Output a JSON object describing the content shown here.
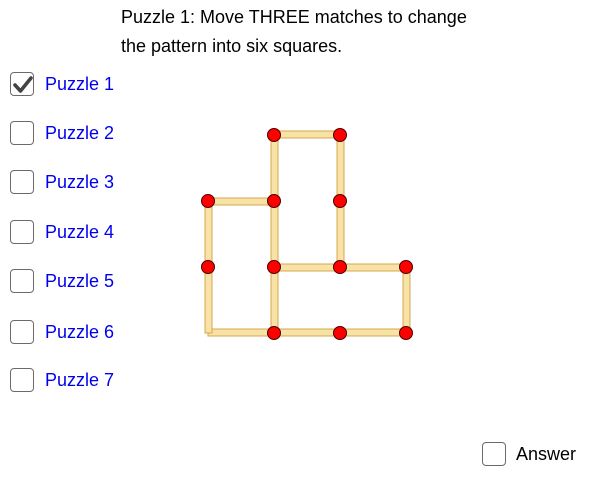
{
  "instructions": {
    "line1": "Puzzle 1:  Move THREE matches to change",
    "line2": "the pattern into six squares."
  },
  "puzzles": [
    {
      "label": "Puzzle 1",
      "checked": true
    },
    {
      "label": "Puzzle 2",
      "checked": false
    },
    {
      "label": "Puzzle 3",
      "checked": false
    },
    {
      "label": "Puzzle 4",
      "checked": false
    },
    {
      "label": "Puzzle 5",
      "checked": false
    },
    {
      "label": "Puzzle 6",
      "checked": false
    },
    {
      "label": "Puzzle 7",
      "checked": false
    }
  ],
  "answer": {
    "label": "Answer",
    "checked": false
  },
  "colors": {
    "match_fill": "#f7e2a8",
    "match_edge": "#d9a74a",
    "node_fill": "#ff0000",
    "node_edge": "#4a0000",
    "label_link": "#0000ee",
    "checkmark": "#444444"
  }
}
